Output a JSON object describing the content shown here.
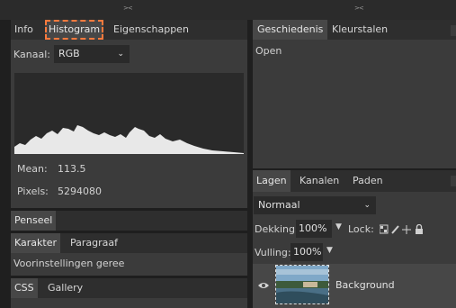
{
  "left": {
    "tabs": [
      "Info",
      "Histogram",
      "Eigenschappen"
    ],
    "channel_label": "Kanaal:",
    "channel_value": "RGB",
    "stats": [
      {
        "label": "Mean:",
        "value": "113.5"
      },
      {
        "label": "Pixels:",
        "value": "5294080"
      }
    ],
    "brush_label": "Penseel",
    "char_tabs": [
      "Karakter",
      "Paragraaf"
    ],
    "presets_label": "Voorinstellingen geree",
    "bottom_tabs": [
      "CSS",
      "Gallery"
    ]
  },
  "right": {
    "top_tabs": [
      "Geschiedenis",
      "Kleurstalen"
    ],
    "history_items": [
      "Open"
    ],
    "layer_tabs": [
      "Lagen",
      "Kanalen",
      "Paden"
    ],
    "blend_mode": "Normaal",
    "opacity_label": "Dekking:",
    "opacity_value": "100%",
    "lock_label": "Lock:",
    "fill_label": "Vulling:",
    "fill_value": "100%",
    "layer_name": "Background"
  },
  "icons": {
    "collapse": "collapse-grip-icon",
    "dropdown": "chevron-down-icon",
    "eye": "eye-icon",
    "lock_icons": [
      "lock-transparency-icon",
      "lock-paint-icon",
      "lock-move-icon",
      "lock-all-icon"
    ]
  },
  "colors": {
    "highlight_outline": "#ff7a3d",
    "panel_bg": "#3b3b3b",
    "histogram_fill": "#e8e8e8"
  }
}
